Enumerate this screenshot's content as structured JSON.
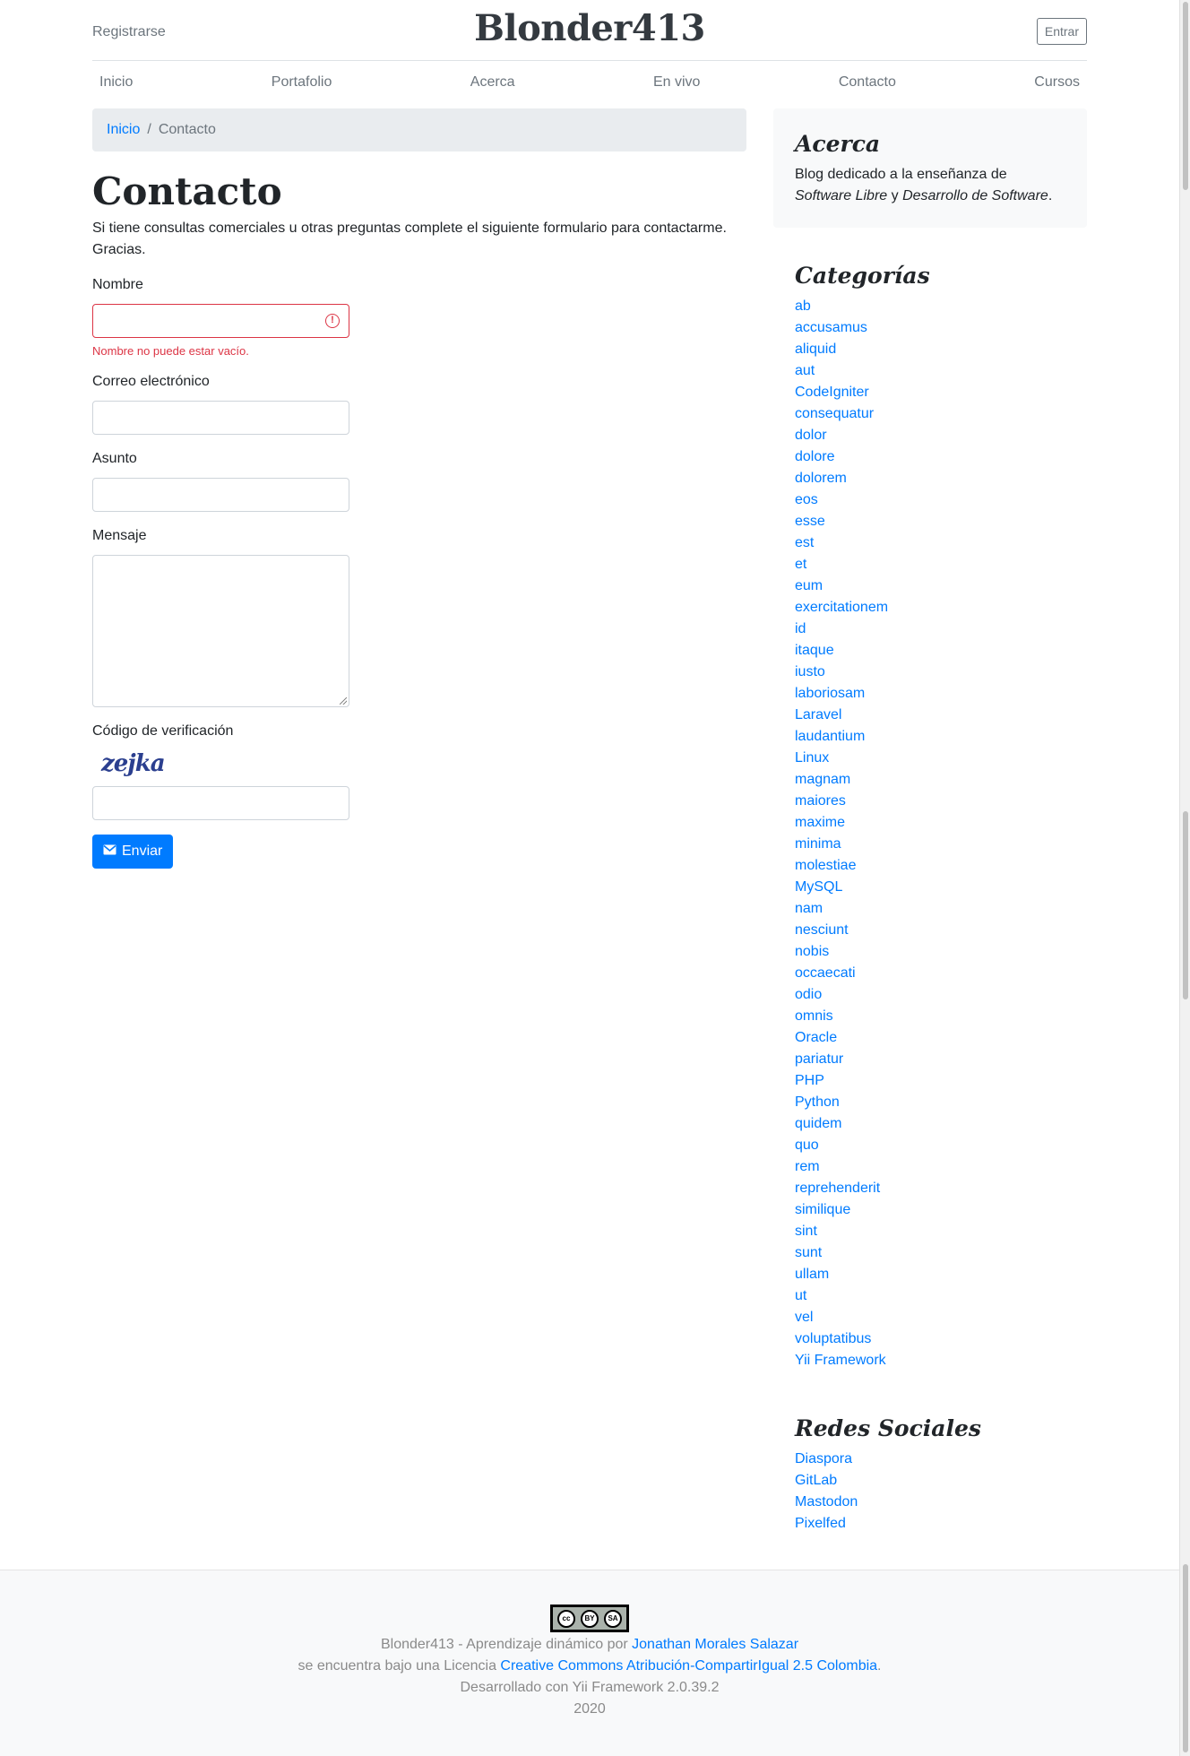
{
  "header": {
    "register": "Registrarse",
    "brand": "Blonder413",
    "login": "Entrar"
  },
  "nav": [
    "Inicio",
    "Portafolio",
    "Acerca",
    "En vivo",
    "Contacto",
    "Cursos"
  ],
  "breadcrumb": {
    "home": "Inicio",
    "separator": "/",
    "current": "Contacto"
  },
  "page": {
    "title": "Contacto",
    "intro": "Si tiene consultas comerciales u otras preguntas complete el siguiente formulario para contactarme. Gracias."
  },
  "form": {
    "name_label": "Nombre",
    "name_error": "Nombre no puede estar vacío.",
    "email_label": "Correo electrónico",
    "subject_label": "Asunto",
    "message_label": "Mensaje",
    "captcha_label": "Código de verificación",
    "captcha_text": "zejka",
    "submit": "Enviar"
  },
  "sidebar": {
    "about": {
      "title": "Acerca",
      "text_pre": "Blog dedicado a la enseñanza de ",
      "em1": "Software Libre",
      "mid": " y ",
      "em2": "Desarrollo de Software",
      "end": "."
    },
    "categories": {
      "title": "Categorías",
      "items": [
        "ab",
        "accusamus",
        "aliquid",
        "aut",
        "CodeIgniter",
        "consequatur",
        "dolor",
        "dolore",
        "dolorem",
        "eos",
        "esse",
        "est",
        "et",
        "eum",
        "exercitationem",
        "id",
        "itaque",
        "iusto",
        "laboriosam",
        "Laravel",
        "laudantium",
        "Linux",
        "magnam",
        "maiores",
        "maxime",
        "minima",
        "molestiae",
        "MySQL",
        "nam",
        "nesciunt",
        "nobis",
        "occaecati",
        "odio",
        "omnis",
        "Oracle",
        "pariatur",
        "PHP",
        "Python",
        "quidem",
        "quo",
        "rem",
        "reprehenderit",
        "similique",
        "sint",
        "sunt",
        "ullam",
        "ut",
        "vel",
        "voluptatibus",
        "Yii Framework"
      ]
    },
    "social": {
      "title": "Redes Sociales",
      "items": [
        "Diaspora",
        "GitLab",
        "Mastodon",
        "Pixelfed"
      ]
    }
  },
  "footer": {
    "badge": [
      "cc",
      "BY",
      "SA"
    ],
    "line1_pre": "Blonder413 - Aprendizaje dinámico por ",
    "author": "Jonathan Morales Salazar",
    "line2_pre": "se encuentra bajo una Licencia ",
    "license": "Creative Commons Atribución-CompartirIgual 2.5 Colombia",
    "line2_end": ".",
    "line3": "Desarrollado con Yii Framework 2.0.39.2",
    "year": "2020"
  },
  "colors": {
    "link": "#007bff",
    "error": "#dc3545",
    "primary_button": "#007bff"
  },
  "icons": {
    "error": "exclamation-circle-icon",
    "send": "envelope-icon",
    "license": "cc-by-sa-badge"
  }
}
